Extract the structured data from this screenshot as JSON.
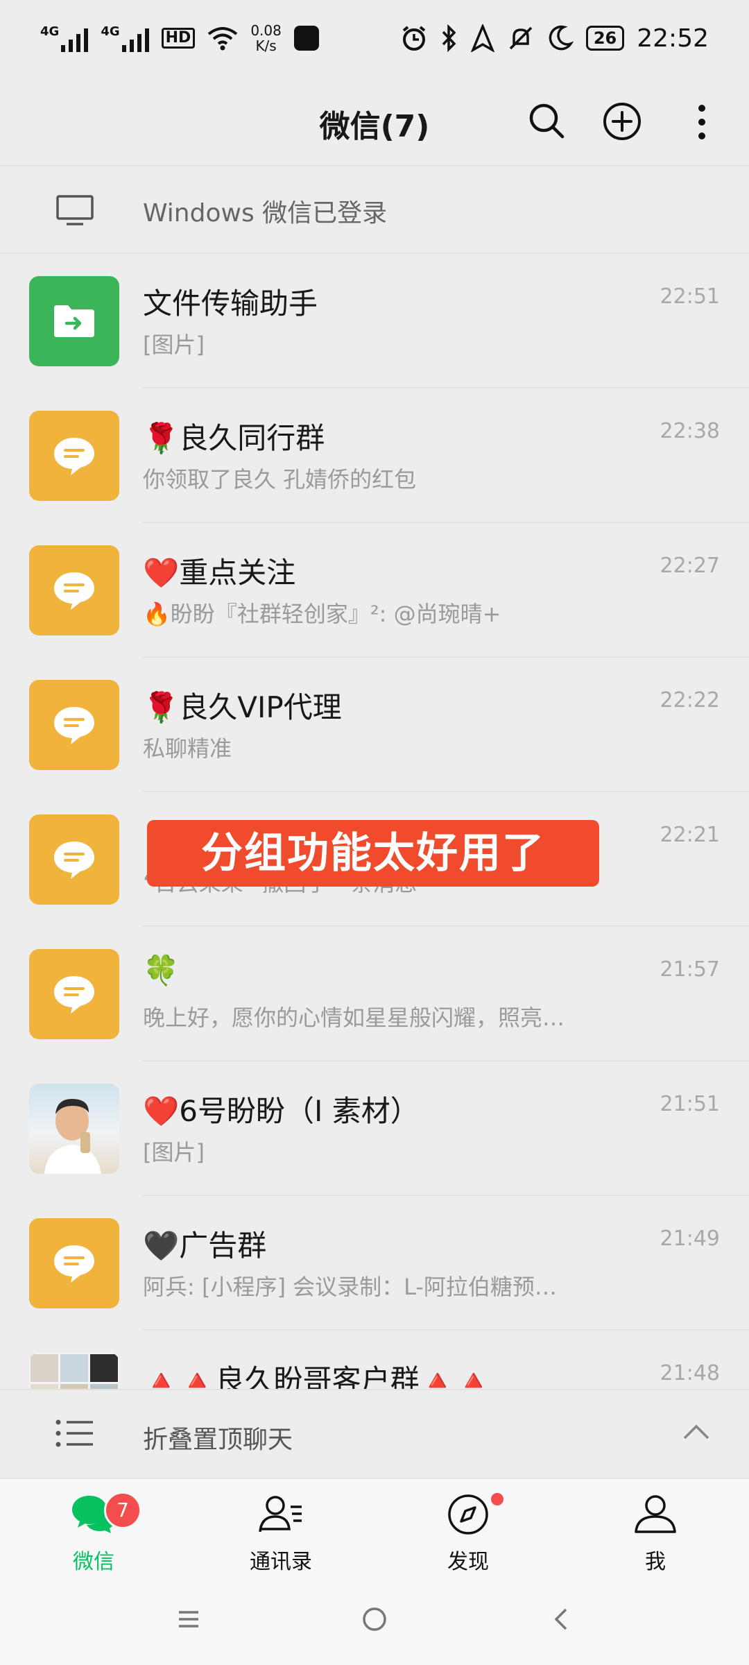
{
  "status_bar": {
    "net1": "4G",
    "net2": "4G",
    "hd": "HD",
    "wifi_gen": "6",
    "speed_value": "0.08",
    "speed_unit": "K/s",
    "battery": "26",
    "time": "22:52"
  },
  "header": {
    "title": "微信(7)"
  },
  "windows_login": {
    "text": "Windows 微信已登录"
  },
  "chats": [
    {
      "name": "文件传输助手",
      "preview": "[图片]",
      "time": "22:51",
      "avatar": "file-transfer"
    },
    {
      "name": "🌹良久同行群",
      "preview": "你领取了良久  孔婧侨的红包",
      "time": "22:38",
      "avatar": "group"
    },
    {
      "name": "❤️重点关注",
      "preview": "🔥盼盼『社群轻创家』²: @尚琬晴+",
      "time": "22:27",
      "avatar": "group"
    },
    {
      "name": "🌹良久VIP代理",
      "preview": "私聊精准",
      "time": "22:22",
      "avatar": "group"
    },
    {
      "name": "",
      "preview": "“日云呆呆” 撤回了一条消息",
      "time": "22:21",
      "avatar": "group"
    },
    {
      "name": "🍀",
      "preview": "晚上好，愿你的心情如星星般闪耀，照亮…",
      "time": "21:57",
      "avatar": "group"
    },
    {
      "name": "❤️6号盼盼（I    素材）",
      "preview": "[图片]",
      "time": "21:51",
      "avatar": "photo"
    },
    {
      "name": "🖤广告群",
      "preview": "阿兵: [小程序] 会议录制：L-阿拉伯糖预…",
      "time": "21:49",
      "avatar": "group"
    },
    {
      "name": "🔺🔺良久盼哥客户群🔺🔺",
      "preview": "",
      "time": "21:48",
      "avatar": "photo-grid"
    }
  ],
  "overlay_banner": "分组功能太好用了",
  "fold_bar": {
    "label": "折叠置顶聊天"
  },
  "bottom_nav": {
    "tabs": [
      {
        "label": "微信",
        "icon": "chat-bubbles-icon",
        "badge": "7",
        "active": true
      },
      {
        "label": "通讯录",
        "icon": "contacts-icon"
      },
      {
        "label": "发现",
        "icon": "compass-icon",
        "dot": true
      },
      {
        "label": "我",
        "icon": "person-icon"
      }
    ]
  },
  "colors": {
    "accent": "#07c160",
    "group_avatar": "#f0b43c",
    "file_avatar": "#3cb55a",
    "banner": "#ef4b2c",
    "badge": "#f44d4d"
  }
}
